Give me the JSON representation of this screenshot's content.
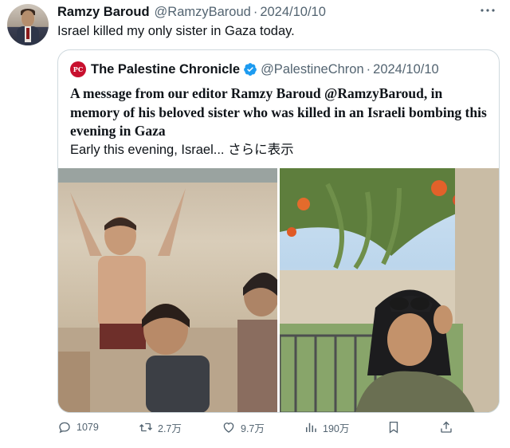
{
  "tweet": {
    "author_name": "Ramzy Baroud",
    "handle": "@RamzyBaroud",
    "separator": "·",
    "date": "2024/10/10",
    "text": "Israel killed my only sister in Gaza today.",
    "more_icon": "more-dots-icon"
  },
  "quote": {
    "logo_text": "PC",
    "author_name": "The Palestine Chronicle",
    "verified_icon": "verified-badge-icon",
    "handle": "@PalestineChron",
    "separator": "·",
    "date": "2024/10/10",
    "bold_text_1": "A message from our editor Ramzy Baroud ",
    "bold_mention": "@RamzyBaroud",
    "bold_text_2": ", in memory of his beloved sister who was killed in an Israeli bombing this evening in Gaza",
    "preview": "Early this evening, Israel... ",
    "show_more": "さらに表示"
  },
  "actions": {
    "reply_count": "1079",
    "retweet_count": "2.7万",
    "like_count": "9.7万",
    "view_count": "190万",
    "icons": [
      "reply-icon",
      "retweet-icon",
      "like-icon",
      "views-icon",
      "bookmark-icon",
      "share-icon"
    ]
  },
  "colors": {
    "text": "#0f1419",
    "muted": "#536471",
    "border": "#cfd9de",
    "verified": "#1d9bf0",
    "brand_red": "#c8102e"
  }
}
